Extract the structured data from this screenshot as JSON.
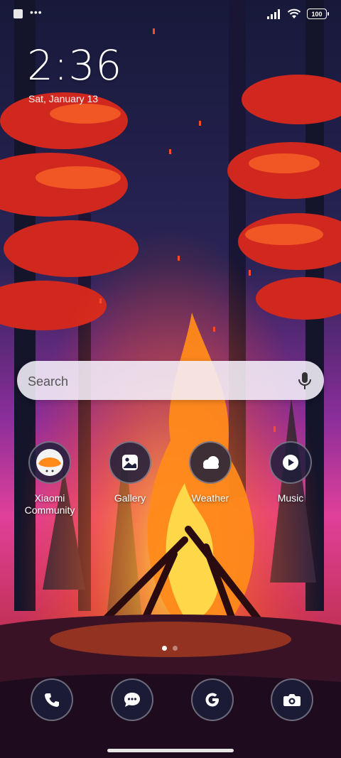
{
  "status": {
    "battery": "100"
  },
  "lockscreen": {
    "time": "2:36",
    "date": "Sat, January 13"
  },
  "search": {
    "label": "Search"
  },
  "apps": [
    {
      "label": "Xiaomi Community",
      "icon": "xiaomi-community-icon"
    },
    {
      "label": "Gallery",
      "icon": "gallery-icon"
    },
    {
      "label": "Weather",
      "icon": "weather-icon"
    },
    {
      "label": "Music",
      "icon": "music-icon"
    }
  ],
  "dock": [
    {
      "icon": "phone-icon"
    },
    {
      "icon": "messages-icon"
    },
    {
      "icon": "google-icon"
    },
    {
      "icon": "camera-icon"
    }
  ],
  "pager": {
    "pages": 2,
    "current": 1
  },
  "colors": {
    "sky_top": "#1b1a3a",
    "sky_bottom": "#d93aa0",
    "fire": "#ff8a1a",
    "icon_bg": "#1c1e3a"
  }
}
